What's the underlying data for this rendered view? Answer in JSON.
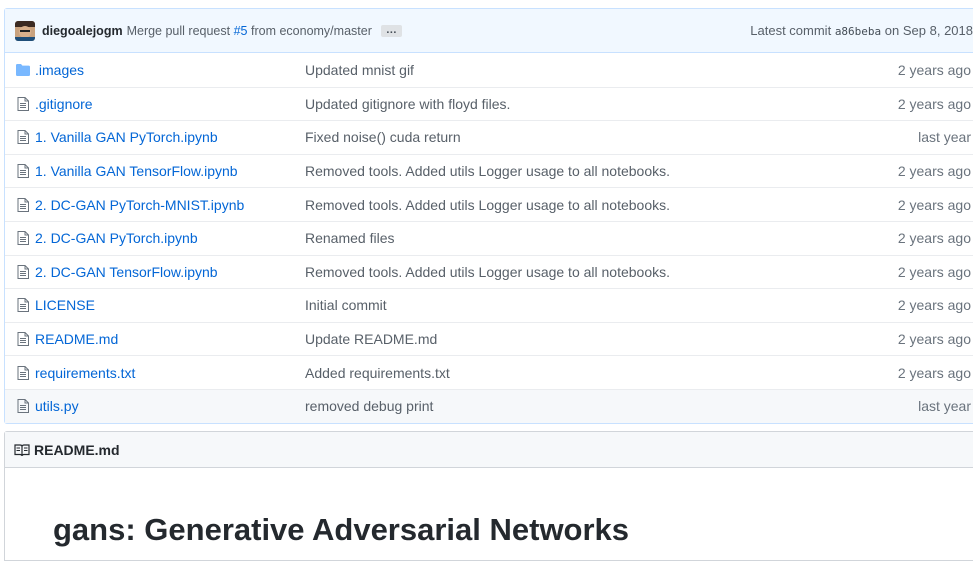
{
  "commit": {
    "author": "diegoalejogm",
    "message_prefix": "Merge pull request",
    "pr_link": "#5",
    "message_suffix": "from economy/master",
    "ellipsis": "…",
    "latest_label": "Latest commit",
    "sha": "a86beba",
    "date": "on Sep 8, 2018"
  },
  "files": [
    {
      "name": ".images",
      "type": "folder",
      "message": "Updated mnist gif",
      "age": "2 years ago"
    },
    {
      "name": ".gitignore",
      "type": "file",
      "message": "Updated gitignore with floyd files.",
      "age": "2 years ago"
    },
    {
      "name": "1. Vanilla GAN PyTorch.ipynb",
      "type": "file",
      "message": "Fixed noise() cuda return",
      "age": "last year"
    },
    {
      "name": "1. Vanilla GAN TensorFlow.ipynb",
      "type": "file",
      "message": "Removed tools. Added utils Logger usage to all notebooks.",
      "age": "2 years ago"
    },
    {
      "name": "2. DC-GAN PyTorch-MNIST.ipynb",
      "type": "file",
      "message": "Removed tools. Added utils Logger usage to all notebooks.",
      "age": "2 years ago"
    },
    {
      "name": "2. DC-GAN PyTorch.ipynb",
      "type": "file",
      "message": "Renamed files",
      "age": "2 years ago"
    },
    {
      "name": "2. DC-GAN TensorFlow.ipynb",
      "type": "file",
      "message": "Removed tools. Added utils Logger usage to all notebooks.",
      "age": "2 years ago"
    },
    {
      "name": "LICENSE",
      "type": "file",
      "message": "Initial commit",
      "age": "2 years ago"
    },
    {
      "name": "README.md",
      "type": "file",
      "message": "Update README.md",
      "age": "2 years ago"
    },
    {
      "name": "requirements.txt",
      "type": "file",
      "message": "Added requirements.txt",
      "age": "2 years ago"
    },
    {
      "name": "utils.py",
      "type": "file",
      "message": "removed debug print",
      "age": "last year",
      "hovered": true
    }
  ],
  "readme": {
    "header": "README.md",
    "title": "gans: Generative Adversarial Networks"
  },
  "colors": {
    "link": "#0366d6",
    "commit_bar_bg": "#f1f8ff",
    "folder_icon": "#79b8ff"
  }
}
